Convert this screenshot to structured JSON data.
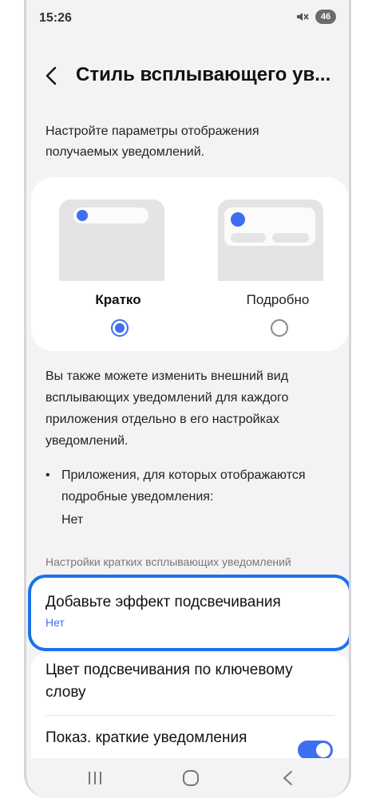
{
  "status_bar": {
    "time": "15:26",
    "battery": "46"
  },
  "header": {
    "title": "Стиль всплывающего ув..."
  },
  "intro_text": "Настройте параметры отображения получаемых уведомлений.",
  "styles": [
    {
      "label": "Кратко",
      "selected": true
    },
    {
      "label": "Подробно",
      "selected": false
    }
  ],
  "description": "Вы также можете изменить внешний вид всплывающих уведомлений для каждого приложения отдельно в его настройках уведомлений.",
  "detailed_apps": {
    "bullet": "•",
    "text": "Приложения, для которых отображаются подробные уведомления:",
    "value": "Нет"
  },
  "section_label": "Настройки кратких всплывающих уведомлений",
  "highlight_item": {
    "title": "Добавьте эффект подсвечивания",
    "subtitle": "Нет"
  },
  "keyword_color_item": {
    "title": "Цвет подсвечивания по ключевому слову"
  },
  "show_brief_item": {
    "title": "Показ. краткие уведомления",
    "enabled": true
  },
  "colors": {
    "accent": "#3e6ff0",
    "highlight_border": "#1a73e8",
    "background": "#f3f3f5"
  },
  "icons": [
    "mute-icon",
    "back-icon",
    "recent-apps-icon",
    "home-icon",
    "nav-back-icon"
  ]
}
